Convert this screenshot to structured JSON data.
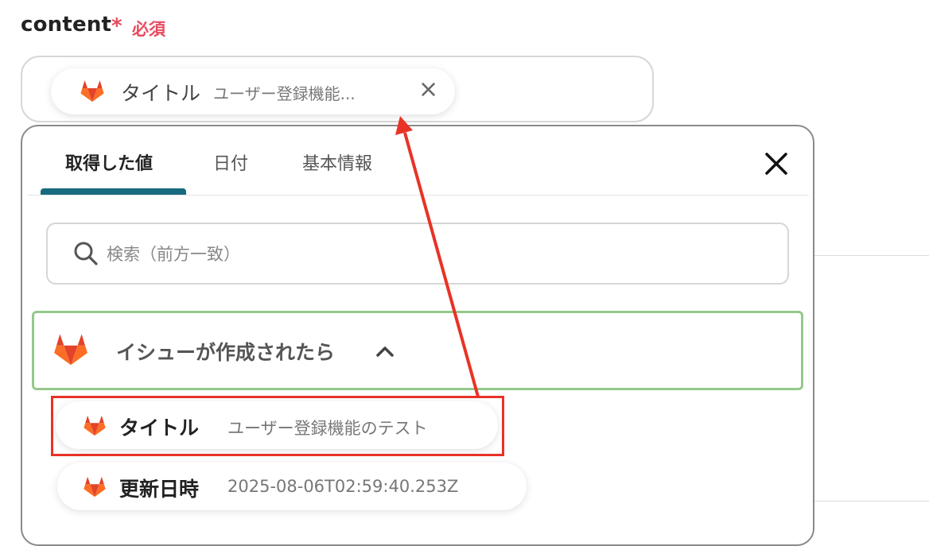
{
  "field": {
    "label": "content",
    "required_star": "*",
    "required_text": "必須"
  },
  "selected_chip": {
    "title": "タイトル",
    "value": "ユーザー登録機能...",
    "close_glyph": "×",
    "icon": "gitlab-icon"
  },
  "panel": {
    "tabs": [
      "取得した値",
      "日付",
      "基本情報"
    ],
    "active_tab": "取得した値",
    "close_icon": "close-icon",
    "search": {
      "placeholder": "検索（前方一致）",
      "icon": "search-icon"
    },
    "group": {
      "label": "イシューが作成されたら",
      "icon": "gitlab-icon",
      "expanded": true,
      "chevron_icon": "chevron-up-icon"
    },
    "items": [
      {
        "title": "タイトル",
        "value": "ユーザー登録機能のテスト",
        "highlighted": true
      },
      {
        "title": "更新日時",
        "value": "2025-08-06T02:59:40.253Z",
        "highlighted": false
      }
    ]
  },
  "colors": {
    "required": "#e84a5f",
    "tab_underline": "#176a80",
    "group_border": "#94c98b",
    "highlight": "#e83326",
    "arrow": "#e83326"
  }
}
